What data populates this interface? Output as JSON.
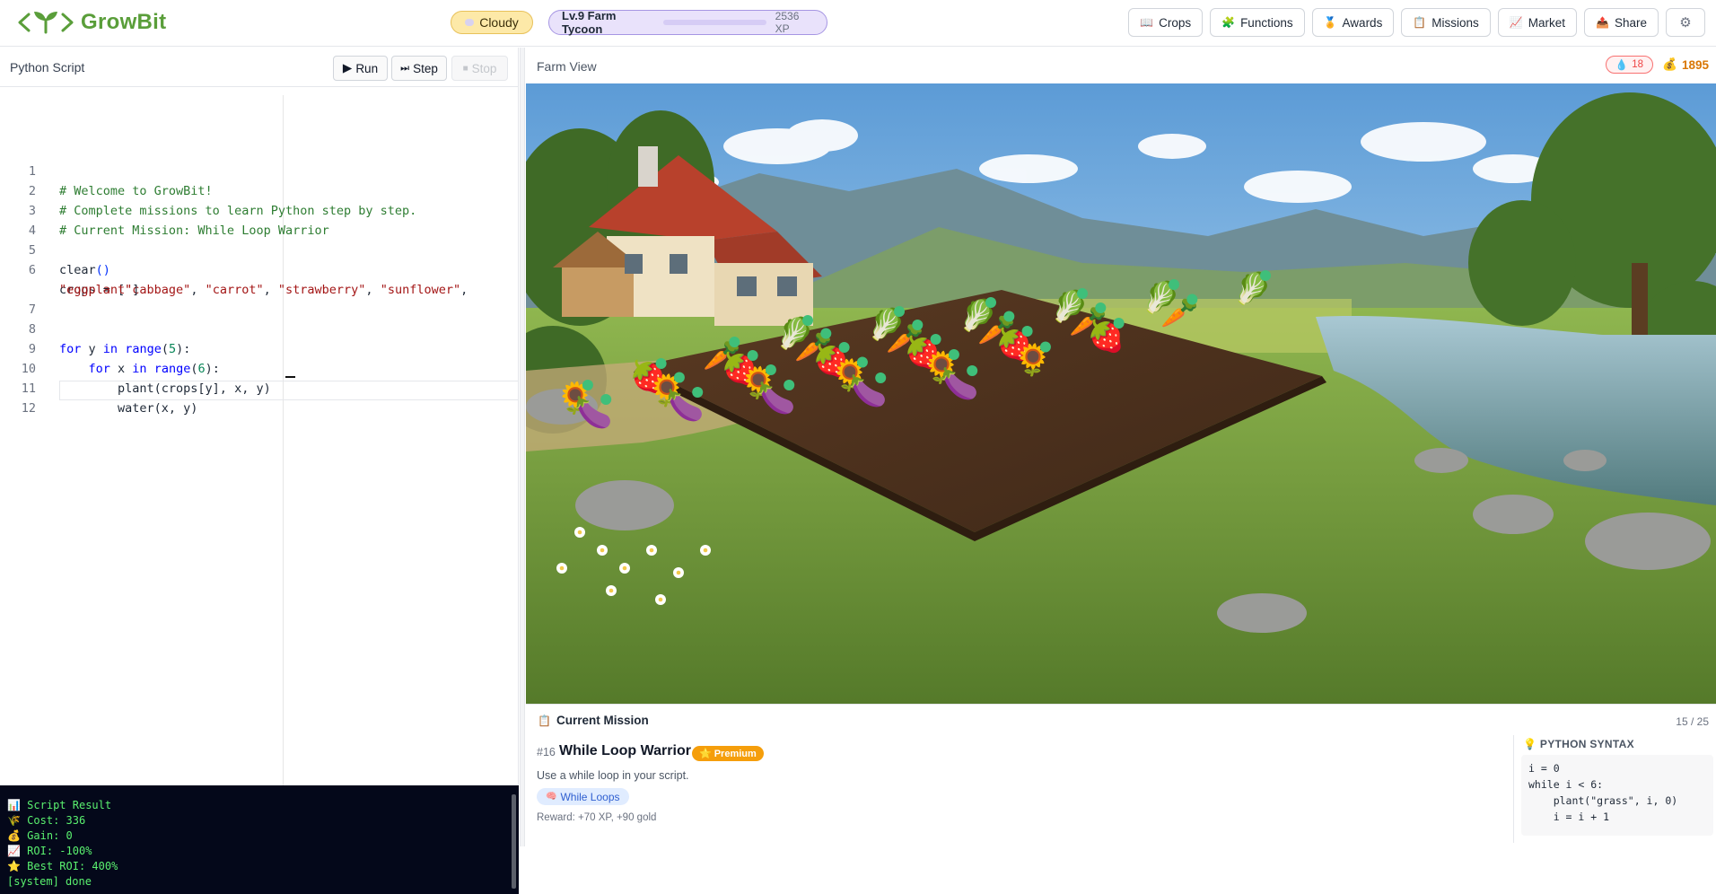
{
  "app": {
    "logo_text": "GrowBit",
    "brand_color": "#5a9e3a"
  },
  "header": {
    "weather": "Cloudy",
    "level_label": "Lv.9 Farm Tycoon",
    "xp_text": "2536 XP",
    "xp_progress": 0.03,
    "nav": [
      {
        "label": "Crops",
        "icon": "book-icon"
      },
      {
        "label": "Functions",
        "icon": "blocks-icon"
      },
      {
        "label": "Awards",
        "icon": "medal-icon"
      },
      {
        "label": "Missions",
        "icon": "clipboard-icon"
      },
      {
        "label": "Market",
        "icon": "chart-icon"
      },
      {
        "label": "Share",
        "icon": "share-icon"
      }
    ],
    "settings_icon": "gear-icon"
  },
  "editor": {
    "title": "Python Script",
    "run_label": "Run",
    "step_label": "Step",
    "stop_label": "Stop",
    "lines": [
      "# Welcome to GrowBit!",
      "# Complete missions to learn Python step by step.",
      "# Current Mission: While Loop Warrior",
      "",
      "clear()",
      "crops = [\"cabbage\", \"carrot\", \"strawberry\", \"sunflower\",",
      "\"eggplant\"]",
      "",
      "for y in range(5):",
      "    for x in range(6):",
      "        plant(crops[y], x, y)",
      "        water(x, y)",
      ""
    ],
    "line_numbers": [
      "1",
      "2",
      "3",
      "",
      "4",
      "5",
      "6",
      "",
      "7",
      "8",
      "9",
      "10",
      "11",
      "12"
    ]
  },
  "console": {
    "lines": [
      "📊 Script Result",
      "🌾 Cost: 336",
      "💰 Gain: 0",
      "📈 ROI: -100%",
      "⭐ Best ROI: 400%",
      "[system] done"
    ]
  },
  "farm": {
    "title": "Farm View",
    "water_count": "18",
    "gold": "1895",
    "grid_rows": [
      "cabbage",
      "carrot",
      "strawberry",
      "sunflower",
      "eggplant"
    ],
    "grid_cols": 6
  },
  "mission": {
    "header": "Current Mission",
    "progress": "15 / 25",
    "number": "#16",
    "title": "While Loop Warrior",
    "badge": "Premium",
    "description": "Use a while loop in your script.",
    "tag": "While Loops",
    "reward": "Reward: +70 XP, +90 gold",
    "syntax_title": "PYTHON SYNTAX",
    "syntax_lines": [
      "i = 0",
      "while i < 6:",
      "    plant(\"grass\", i, 0)",
      "    i = i + 1"
    ]
  }
}
